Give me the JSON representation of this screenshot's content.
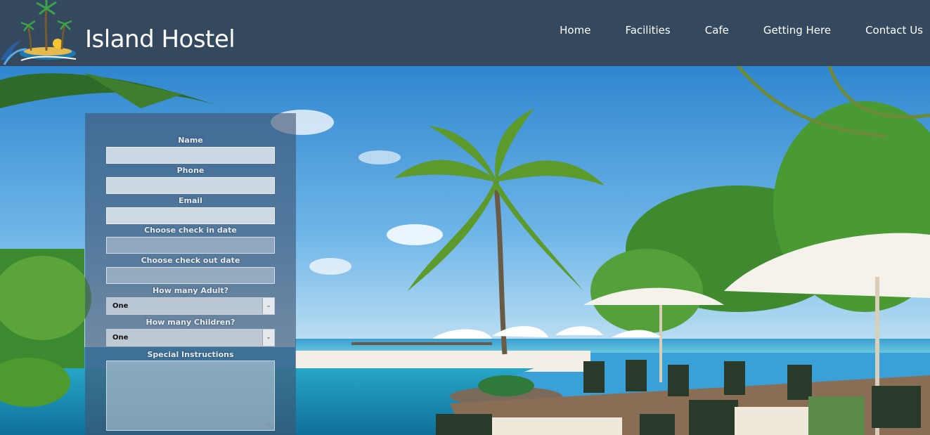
{
  "header": {
    "brand": "Island Hostel",
    "logo_icon": "palm-island-logo",
    "background": "#34495e"
  },
  "nav": {
    "items": [
      {
        "label": "Home"
      },
      {
        "label": "Facilities"
      },
      {
        "label": "Cafe"
      },
      {
        "label": "Getting Here"
      },
      {
        "label": "Contact Us"
      }
    ]
  },
  "form": {
    "name_label": "Name",
    "phone_label": "Phone",
    "email_label": "Email",
    "checkin_label": "Choose check in date",
    "checkout_label": "Choose check out date",
    "adults_label": "How many Adult?",
    "adults_value": "One",
    "children_label": "How many Children?",
    "children_value": "One",
    "instructions_label": "Special Instructions"
  },
  "icons": {
    "select_arrow": "chevron-down-icon",
    "resize_grip": "resize-grip-icon"
  }
}
